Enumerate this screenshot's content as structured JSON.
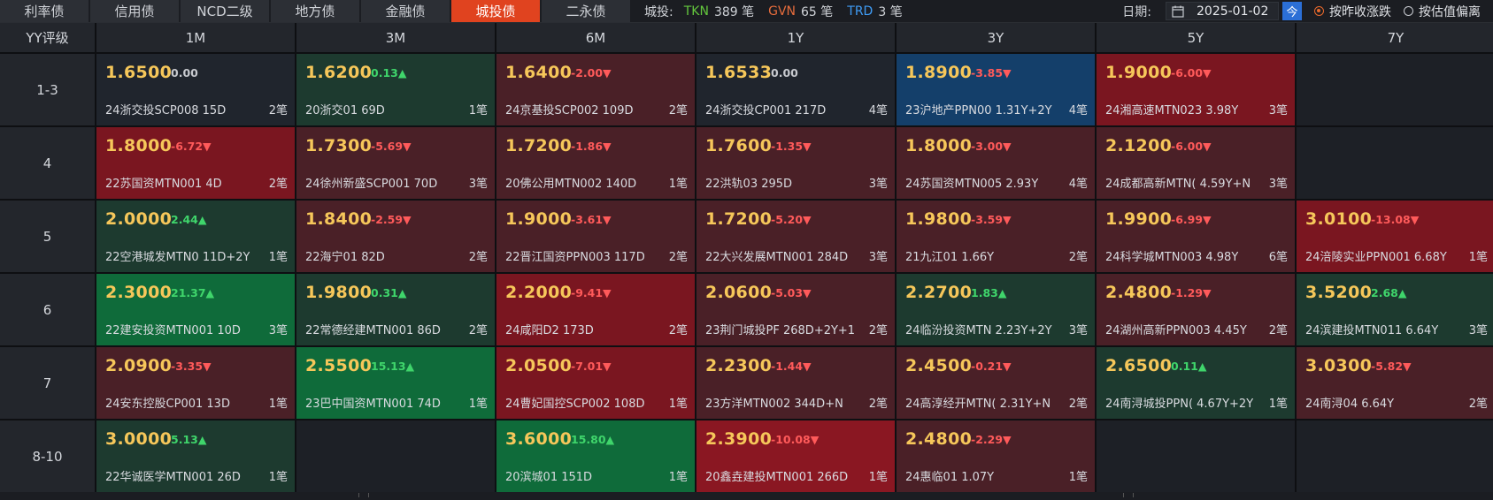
{
  "tabs": [
    {
      "label": "利率债",
      "active": false
    },
    {
      "label": "信用债",
      "active": false
    },
    {
      "label": "NCD二级",
      "active": false
    },
    {
      "label": "地方债",
      "active": false
    },
    {
      "label": "金融债",
      "active": false
    },
    {
      "label": "城投债",
      "active": true
    },
    {
      "label": "二永债",
      "active": false
    }
  ],
  "counts": {
    "label": "城投:",
    "tkn_label": "TKN",
    "tkn_value": "389 笔",
    "gvn_label": "GVN",
    "gvn_value": "65 笔",
    "trd_label": "TRD",
    "trd_value": "3 笔"
  },
  "controls": {
    "date_label": "日期:",
    "date_value": "2025-01-02",
    "today_glyph": "今",
    "radio_change": "按昨收涨跌",
    "radio_deviation": "按估值偏离",
    "selected": "change"
  },
  "colors": {
    "red": "#7a1620",
    "deep_red": "#8a1722",
    "dark_red": "#4a2027",
    "green": "#0f6b3a",
    "dark_green": "#1d3a2f",
    "blue": "#143f6a",
    "neutral": "#20252d"
  },
  "table": {
    "corner": "YY评级",
    "columns": [
      "1M",
      "3M",
      "6M",
      "1Y",
      "3Y",
      "5Y",
      "7Y"
    ],
    "rows": [
      {
        "label": "1-3",
        "cells": [
          {
            "yield": "1.6500",
            "change": "0.00",
            "dir": "flat",
            "bond": "24浙交投SCP008 15D",
            "count": "2笔",
            "bg": "neutral"
          },
          {
            "yield": "1.6200",
            "change": "0.13▲",
            "dir": "up",
            "bond": "20浙交01 69D",
            "count": "1笔",
            "bg": "dark_green"
          },
          {
            "yield": "1.6400",
            "change": "-2.00▼",
            "dir": "down",
            "bond": "24京基投SCP002 109D",
            "count": "2笔",
            "bg": "dark_red"
          },
          {
            "yield": "1.6533",
            "change": "0.00",
            "dir": "flat",
            "bond": "24浙交投CP001 217D",
            "count": "4笔",
            "bg": "neutral"
          },
          {
            "yield": "1.8900",
            "change": "-3.85▼",
            "dir": "down",
            "bond": "23沪地产PPN00 1.31Y+2Y",
            "count": "4笔",
            "bg": "blue"
          },
          {
            "yield": "1.9000",
            "change": "-6.00▼",
            "dir": "down",
            "bond": "24湘高速MTN023 3.98Y",
            "count": "3笔",
            "bg": "red"
          },
          null
        ]
      },
      {
        "label": "4",
        "cells": [
          {
            "yield": "1.8000",
            "change": "-6.72▼",
            "dir": "down",
            "bond": "22苏国资MTN001 4D",
            "count": "2笔",
            "bg": "red"
          },
          {
            "yield": "1.7300",
            "change": "-5.69▼",
            "dir": "down",
            "bond": "24徐州新盛SCP001 70D",
            "count": "3笔",
            "bg": "dark_red"
          },
          {
            "yield": "1.7200",
            "change": "-1.86▼",
            "dir": "down",
            "bond": "20佛公用MTN002 140D",
            "count": "1笔",
            "bg": "dark_red"
          },
          {
            "yield": "1.7600",
            "change": "-1.35▼",
            "dir": "down",
            "bond": "22洪轨03 295D",
            "count": "3笔",
            "bg": "dark_red"
          },
          {
            "yield": "1.8000",
            "change": "-3.00▼",
            "dir": "down",
            "bond": "24苏国资MTN005 2.93Y",
            "count": "4笔",
            "bg": "dark_red"
          },
          {
            "yield": "2.1200",
            "change": "-6.00▼",
            "dir": "down",
            "bond": "24成都高新MTN( 4.59Y+N",
            "count": "3笔",
            "bg": "dark_red"
          },
          null
        ]
      },
      {
        "label": "5",
        "cells": [
          {
            "yield": "2.0000",
            "change": "2.44▲",
            "dir": "up",
            "bond": "22空港城发MTN0 11D+2Y",
            "count": "1笔",
            "bg": "dark_green"
          },
          {
            "yield": "1.8400",
            "change": "-2.59▼",
            "dir": "down",
            "bond": "22海宁01 82D",
            "count": "2笔",
            "bg": "dark_red"
          },
          {
            "yield": "1.9000",
            "change": "-3.61▼",
            "dir": "down",
            "bond": "22晋江国资PPN003 117D",
            "count": "2笔",
            "bg": "dark_red"
          },
          {
            "yield": "1.7200",
            "change": "-5.20▼",
            "dir": "down",
            "bond": "22大兴发展MTN001 284D",
            "count": "3笔",
            "bg": "dark_red"
          },
          {
            "yield": "1.9800",
            "change": "-3.59▼",
            "dir": "down",
            "bond": "21九江01 1.66Y",
            "count": "2笔",
            "bg": "dark_red"
          },
          {
            "yield": "1.9900",
            "change": "-6.99▼",
            "dir": "down",
            "bond": "24科学城MTN003 4.98Y",
            "count": "6笔",
            "bg": "dark_red"
          },
          {
            "yield": "3.0100",
            "change": "-13.08▼",
            "dir": "down",
            "bond": "24涪陵实业PPN001 6.68Y",
            "count": "1笔",
            "bg": "red"
          }
        ]
      },
      {
        "label": "6",
        "cells": [
          {
            "yield": "2.3000",
            "change": "21.37▲",
            "dir": "up",
            "bond": "22建安投资MTN001 10D",
            "count": "3笔",
            "bg": "green"
          },
          {
            "yield": "1.9800",
            "change": "0.31▲",
            "dir": "up",
            "bond": "22常德经建MTN001 86D",
            "count": "2笔",
            "bg": "dark_green"
          },
          {
            "yield": "2.2000",
            "change": "-9.41▼",
            "dir": "down",
            "bond": "24咸阳D2 173D",
            "count": "2笔",
            "bg": "red"
          },
          {
            "yield": "2.0600",
            "change": "-5.03▼",
            "dir": "down",
            "bond": "23荆门城投PF 268D+2Y+1",
            "count": "2笔",
            "bg": "dark_red"
          },
          {
            "yield": "2.2700",
            "change": "1.83▲",
            "dir": "up",
            "bond": "24临汾投资MTN 2.23Y+2Y",
            "count": "3笔",
            "bg": "dark_green"
          },
          {
            "yield": "2.4800",
            "change": "-1.29▼",
            "dir": "down",
            "bond": "24湖州高新PPN003 4.45Y",
            "count": "2笔",
            "bg": "dark_red"
          },
          {
            "yield": "3.5200",
            "change": "2.68▲",
            "dir": "up",
            "bond": "24滨建投MTN011 6.64Y",
            "count": "3笔",
            "bg": "dark_green"
          }
        ]
      },
      {
        "label": "7",
        "cells": [
          {
            "yield": "2.0900",
            "change": "-3.35▼",
            "dir": "down",
            "bond": "24安东控股CP001 13D",
            "count": "1笔",
            "bg": "dark_red"
          },
          {
            "yield": "2.5500",
            "change": "15.13▲",
            "dir": "up",
            "bond": "23巴中国资MTN001 74D",
            "count": "1笔",
            "bg": "green"
          },
          {
            "yield": "2.0500",
            "change": "-7.01▼",
            "dir": "down",
            "bond": "24曹妃国控SCP002 108D",
            "count": "1笔",
            "bg": "red"
          },
          {
            "yield": "2.2300",
            "change": "-1.44▼",
            "dir": "down",
            "bond": "23方洋MTN002 344D+N",
            "count": "2笔",
            "bg": "dark_red"
          },
          {
            "yield": "2.4500",
            "change": "-0.21▼",
            "dir": "down",
            "bond": "24高淳经开MTN( 2.31Y+N",
            "count": "2笔",
            "bg": "dark_red"
          },
          {
            "yield": "2.6500",
            "change": "0.11▲",
            "dir": "up",
            "bond": "24南浔城投PPN( 4.67Y+2Y",
            "count": "1笔",
            "bg": "dark_green"
          },
          {
            "yield": "3.0300",
            "change": "-5.82▼",
            "dir": "down",
            "bond": "24南浔04 6.64Y",
            "count": "2笔",
            "bg": "dark_red"
          }
        ]
      },
      {
        "label": "8-10",
        "cells": [
          {
            "yield": "3.0000",
            "change": "5.13▲",
            "dir": "up",
            "bond": "22华诚医学MTN001 26D",
            "count": "1笔",
            "bg": "dark_green"
          },
          null,
          {
            "yield": "3.6000",
            "change": "15.80▲",
            "dir": "up",
            "bond": "20滨城01 151D",
            "count": "1笔",
            "bg": "green"
          },
          {
            "yield": "2.3900",
            "change": "-10.08▼",
            "dir": "down",
            "bond": "20鑫垚建投MTN001 266D",
            "count": "1笔",
            "bg": "deep_red"
          },
          {
            "yield": "2.4800",
            "change": "-2.29▼",
            "dir": "down",
            "bond": "24惠临01 1.07Y",
            "count": "1笔",
            "bg": "dark_red"
          },
          null,
          null
        ]
      }
    ]
  }
}
